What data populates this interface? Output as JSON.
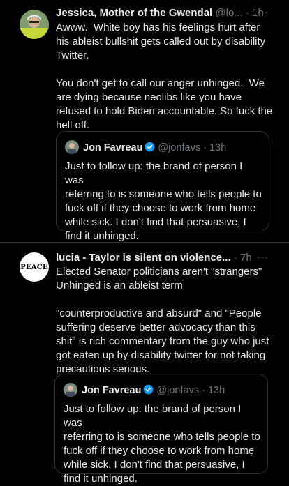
{
  "tweets": [
    {
      "author_name": "Jessica, Mother of the Gwendal",
      "handle": "@lo...",
      "time": "· 1h",
      "more_label": "···",
      "text": "Awww.  White boy has his feelings hurt after\nhis ableist bullshit gets called out by disability\nTwitter.\n\nYou don't get to call our anger unhinged.  We\nare dying because neolibs like you have\nrefused to hold Biden accountable. So fuck the\nhell off.",
      "quote": {
        "author_name": "Jon Favreau",
        "handle": "@jonfavs",
        "time": "· 13h",
        "text": "Just to follow up: the brand of person I was\nreferring to is someone who tells people to\nfuck off if they choose to work from home\nwhile sick. I don't find that persuasive, I\nfind it unhinged."
      }
    },
    {
      "author_name": "lucia - Taylor is silent on violence...",
      "handle": "",
      "time": "· 7h",
      "more_label": "···",
      "avatar_text": "PEACE",
      "text": "Elected Senator politicians aren't \"strangers\"\nUnhinged is an ableist term\n\n\"counterproductive and absurd\" and \"People\nsuffering deserve better advocacy than this\nshit\" is rich commentary from the guy who just\ngot eaten up by disability twitter for not taking\nprecautions serious.",
      "quote": {
        "author_name": "Jon Favreau",
        "handle": "@jonfavs",
        "time": "· 13h",
        "text": "Just to follow up: the brand of person I was\nreferring to is someone who tells people to\nfuck off if they choose to work from home\nwhile sick. I don't find that persuasive, I\nfind it unhinged."
      }
    }
  ],
  "colors": {
    "background": "#000000",
    "text": "#e7e9ea",
    "muted": "#71767b",
    "border": "#2f3336",
    "verified": "#1d9bf0"
  },
  "icons": [
    "more-icon",
    "verified-badge-icon"
  ]
}
